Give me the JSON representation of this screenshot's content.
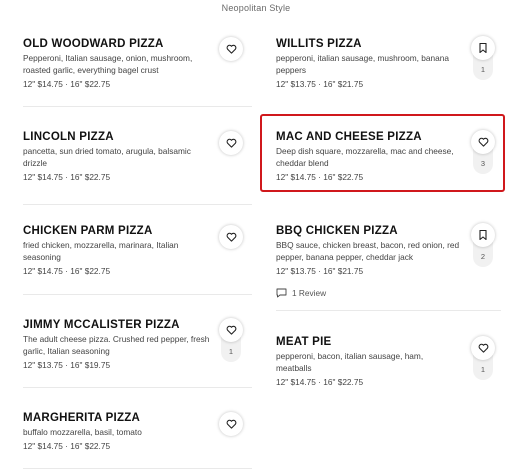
{
  "section_title": "Neopolitan Style",
  "items": [
    {
      "name": "OLD WOODWARD PIZZA",
      "desc": "Pepperoni, Italian sausage, onion, mushroom, roasted garlic, everything bagel crust",
      "price": "12\" $14.75 · 16\" $22.75",
      "action_icon": "heart-icon"
    },
    {
      "name": "WILLITS PIZZA",
      "desc": "pepperoni, italian sausage, mushroom, banana peppers",
      "price": "12\" $13.75 · 16\" $21.75",
      "action_icon": "bookmark-icon",
      "count": "1"
    },
    {
      "name": "LINCOLN PIZZA",
      "desc": "pancetta, sun dried tomato, arugula, balsamic drizzle",
      "price": "12\" $14.75 · 16\" $22.75",
      "action_icon": "heart-icon"
    },
    {
      "name": "MAC AND CHEESE PIZZA",
      "desc": "Deep dish square, mozzarella, mac and cheese, cheddar blend",
      "price": "12\" $14.75 · 16\" $22.75",
      "action_icon": "heart-icon",
      "count": "3",
      "highlighted": true,
      "highlight_color": "#d0181c"
    },
    {
      "name": "CHICKEN PARM PIZZA",
      "desc": "fried chicken, mozzarella, marinara, Italian seasoning",
      "price": "12\" $14.75 · 16\" $22.75",
      "action_icon": "heart-icon"
    },
    {
      "name": "BBQ CHICKEN PIZZA",
      "desc": "BBQ sauce, chicken breast, bacon, red onion, red pepper, banana pepper, cheddar jack",
      "price": "12\" $13.75 · 16\" $21.75",
      "action_icon": "bookmark-icon",
      "count": "2",
      "review": "1 Review"
    },
    {
      "name": "JIMMY MCCALISTER PIZZA",
      "desc": "The adult cheese pizza. Crushed red pepper, fresh garlic, Italian seasoning",
      "price": "12\" $13.75 · 16\" $19.75",
      "action_icon": "heart-icon",
      "count": "1"
    },
    {
      "name": "MEAT PIE",
      "desc": "pepperoni, bacon, italian sausage, ham, meatballs",
      "price": "12\" $14.75 · 16\" $22.75",
      "action_icon": "heart-icon",
      "count": "1"
    },
    {
      "name": "MARGHERITA PIZZA",
      "desc": "buffalo mozzarella, basil, tomato",
      "price": "12\" $14.75 · 16\" $22.75",
      "action_icon": "heart-icon"
    }
  ]
}
